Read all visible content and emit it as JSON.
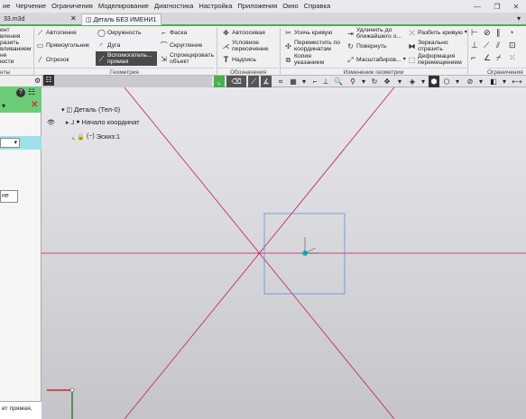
{
  "menubar": {
    "items": [
      "ие",
      "Черчение",
      "Ограничения",
      "Моделирование",
      "Диагностика",
      "Настройка",
      "Приложения",
      "Окно",
      "Справка"
    ]
  },
  "tabs": {
    "file1": "33.m3d",
    "file2": "Деталь БЕЗ ИМЕНИ1"
  },
  "ribbon": {
    "left_cut": [
      "ент",
      "вления",
      "разить",
      "вливанием",
      "не",
      "юсти",
      "нты"
    ],
    "geometry": {
      "autoline": "Автолиния",
      "rectangle": "Прямоугольник",
      "segment": "Отрезок",
      "circle": "Окружность",
      "arc": "Дуга",
      "aux_line_1": "Вспомогатель...",
      "aux_line_2": "прямая",
      "chamfer": "Фаска",
      "fillet": "Скругление",
      "project_1": "Спроецировать",
      "project_2": "объект",
      "group_label": "Геометрия"
    },
    "designations": {
      "axial": "Автоосевая",
      "cond_1": "Условное",
      "cond_2": "пересечение",
      "label": "Надпись",
      "group_label": "Обозначения"
    },
    "geom_change": {
      "trim": "Усечь кривую",
      "move_coord_1": "Переместить по",
      "move_coord_2": "координатам",
      "copy_1": "Копия",
      "copy_2": "указанием",
      "extend_1": "Удлинить до",
      "extend_2": "ближайшего о...",
      "rotate": "Повернуть",
      "scale": "Масштабиров...",
      "split": "Разбить кривую",
      "mirror_1": "Зеркально",
      "mirror_2": "отразить",
      "deform_1": "Деформация",
      "deform_2": "перемещением",
      "group_label": "Изменение геометрии"
    },
    "constraints_label": "Ограничения"
  },
  "leftpanel": {
    "button_label": "не",
    "status_text": "ет прямая,"
  },
  "tree": {
    "root": "Деталь (Тел-0)",
    "origin": "Начало координат",
    "sketch": "Эскиз:1"
  },
  "colors": {
    "accent_green": "#4caf50",
    "axis_red": "#c2185b",
    "selection_blue": "#5b8fd6",
    "origin_cyan": "#00bcd4"
  }
}
